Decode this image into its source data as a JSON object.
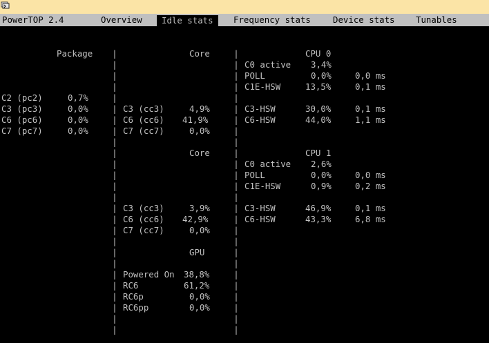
{
  "colors": {
    "titlebar": "#fbe4a6",
    "tabbar": "#c0c0c0",
    "background": "#000000",
    "text": "#c0c0c0"
  },
  "window": {
    "icon": "powertop-app-icon"
  },
  "tabs": {
    "app_name": "PowerTOP 2.4",
    "overview": "Overview",
    "idle": "Idle stats",
    "frequency": "Frequency stats",
    "device": "Device stats",
    "tunables": "Tunables"
  },
  "package": {
    "header": "Package",
    "rows": [
      {
        "state": "C2 (pc2)",
        "value": "0,7%"
      },
      {
        "state": "C3 (pc3)",
        "value": "0,0%"
      },
      {
        "state": "C6 (pc6)",
        "value": "0,0%"
      },
      {
        "state": "C7 (pc7)",
        "value": "0,0%"
      }
    ]
  },
  "core0": {
    "header": "Core",
    "rows": [
      {
        "state": "C3 (cc3)",
        "value": "4,9%"
      },
      {
        "state": "C6 (cc6)",
        "value": "41,9%"
      },
      {
        "state": "C7 (cc7)",
        "value": "0,0%"
      }
    ]
  },
  "cpu0": {
    "header": "CPU 0",
    "rows": [
      {
        "state": "C0 active",
        "value": "3,4%",
        "time": ""
      },
      {
        "state": "POLL",
        "value": "0,0%",
        "time": "0,0 ms"
      },
      {
        "state": "C1E-HSW",
        "value": "13,5%",
        "time": "0,1 ms"
      },
      {
        "state": "C3-HSW",
        "value": "30,0%",
        "time": "0,1 ms"
      },
      {
        "state": "C6-HSW",
        "value": "44,0%",
        "time": "1,1 ms"
      }
    ]
  },
  "core1": {
    "header": "Core",
    "rows": [
      {
        "state": "C3 (cc3)",
        "value": "3,9%"
      },
      {
        "state": "C6 (cc6)",
        "value": "42,9%"
      },
      {
        "state": "C7 (cc7)",
        "value": "0,0%"
      }
    ]
  },
  "cpu1": {
    "header": "CPU 1",
    "rows": [
      {
        "state": "C0 active",
        "value": "2,6%",
        "time": ""
      },
      {
        "state": "POLL",
        "value": "0,0%",
        "time": "0,0 ms"
      },
      {
        "state": "C1E-HSW",
        "value": "0,9%",
        "time": "0,2 ms"
      },
      {
        "state": "C3-HSW",
        "value": "46,9%",
        "time": "0,1 ms"
      },
      {
        "state": "C6-HSW",
        "value": "43,3%",
        "time": "6,8 ms"
      }
    ]
  },
  "gpu": {
    "header": "GPU",
    "rows": [
      {
        "state": "Powered On",
        "value": "38,8%"
      },
      {
        "state": "RC6",
        "value": "61,2%"
      },
      {
        "state": "RC6p",
        "value": "0,0%"
      },
      {
        "state": "RC6pp",
        "value": "0,0%"
      }
    ]
  },
  "separator_char": "|"
}
